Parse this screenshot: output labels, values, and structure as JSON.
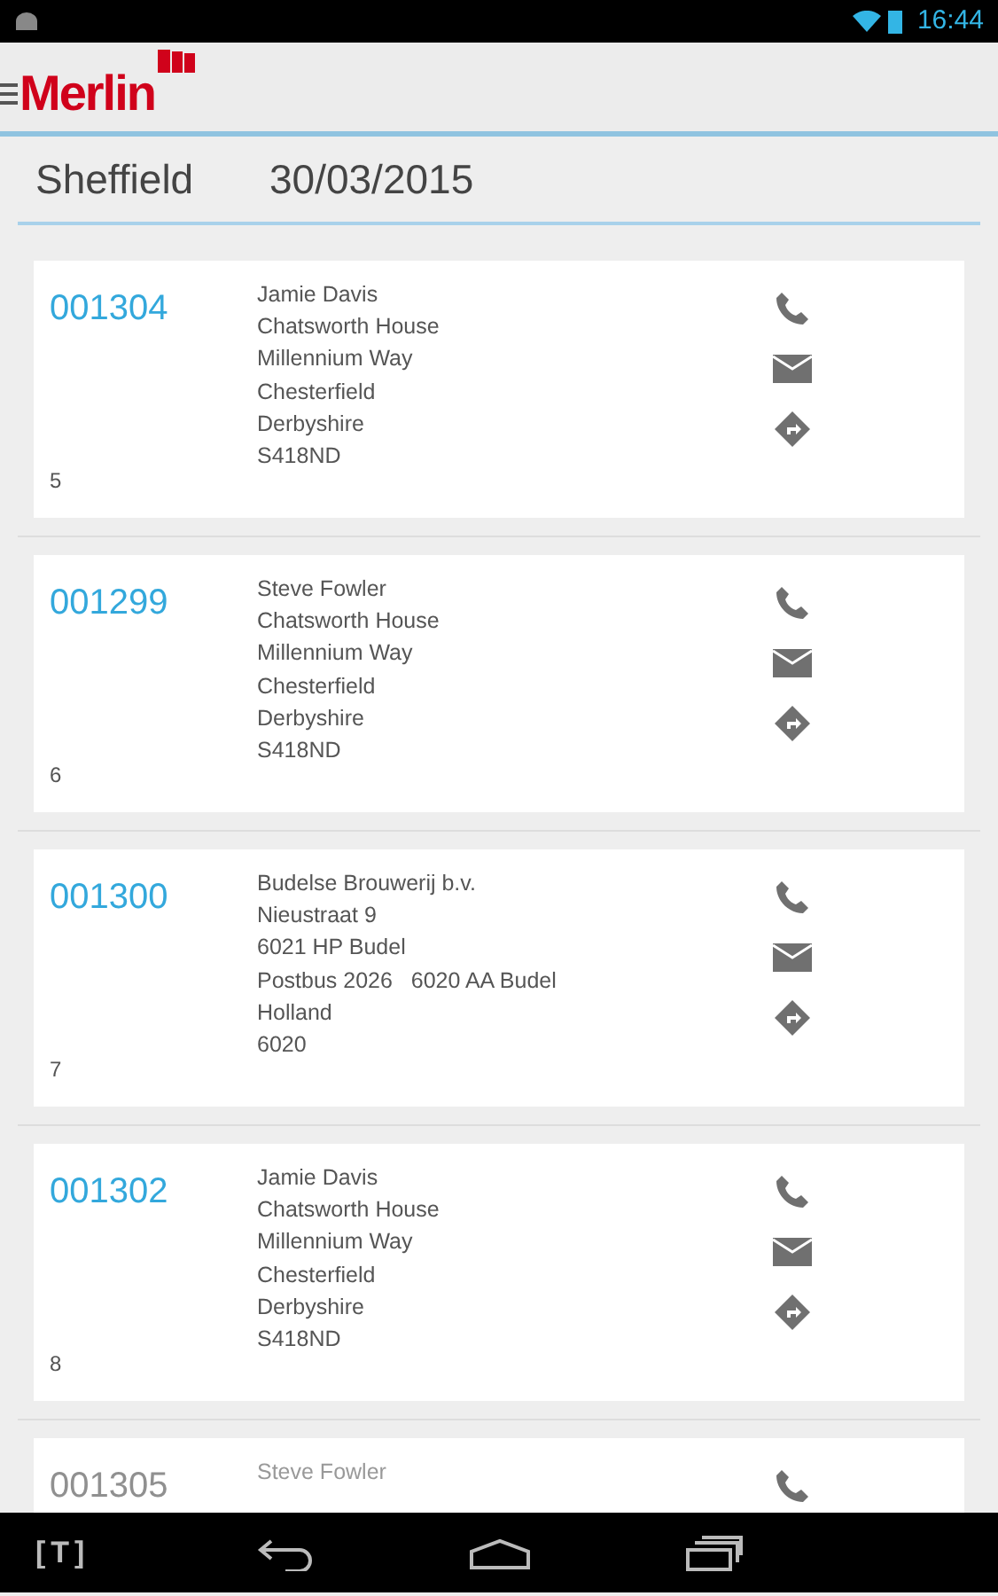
{
  "status_bar": {
    "time": "16:44"
  },
  "app_bar": {
    "logo": "Merlin"
  },
  "header": {
    "location": "Sheffield",
    "date": "30/03/2015"
  },
  "jobs": [
    {
      "number": "001304",
      "dimmed": false,
      "address": [
        "Jamie Davis",
        "Chatsworth House",
        "Millennium Way",
        "Chesterfield",
        "Derbyshire",
        "S418ND"
      ],
      "sequence": "5",
      "actions": [
        {
          "kind": "phone"
        },
        {
          "kind": "email"
        },
        {
          "kind": "directions"
        }
      ]
    },
    {
      "number": "001299",
      "dimmed": false,
      "address": [
        "Steve Fowler",
        "Chatsworth House",
        "Millennium Way",
        "Chesterfield",
        "Derbyshire",
        "S418ND"
      ],
      "sequence": "6",
      "actions": [
        {
          "kind": "phone"
        },
        {
          "kind": "email"
        },
        {
          "kind": "directions"
        }
      ]
    },
    {
      "number": "001300",
      "dimmed": false,
      "address": [
        "Budelse Brouwerij b.v.",
        "Nieustraat 9",
        "6021 HP Budel",
        "Postbus 2026   6020 AA Budel",
        "Holland",
        "6020"
      ],
      "sequence": "7",
      "actions": [
        {
          "kind": "phone"
        },
        {
          "kind": "email"
        },
        {
          "kind": "directions"
        }
      ]
    },
    {
      "number": "001302",
      "dimmed": false,
      "address": [
        "Jamie Davis",
        "Chatsworth House",
        "Millennium Way",
        "Chesterfield",
        "Derbyshire",
        "S418ND"
      ],
      "sequence": "8",
      "actions": [
        {
          "kind": "phone"
        },
        {
          "kind": "email"
        },
        {
          "kind": "directions"
        }
      ]
    },
    {
      "number": "001305",
      "dimmed": true,
      "address": [
        "Steve Fowler"
      ],
      "actions": [
        {
          "kind": "phone"
        }
      ]
    }
  ],
  "nav_bar": {
    "app_label": "[T]"
  }
}
